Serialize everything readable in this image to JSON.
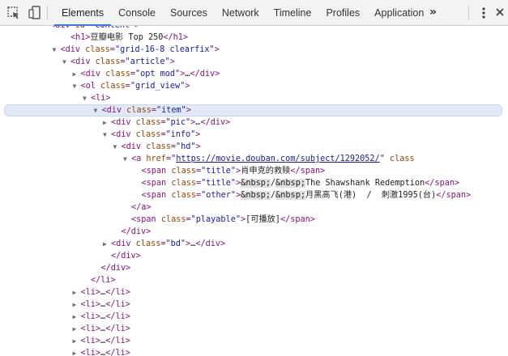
{
  "toolbar": {
    "tabs": [
      {
        "label": "Elements",
        "active": true
      },
      {
        "label": "Console",
        "active": false
      },
      {
        "label": "Sources",
        "active": false
      },
      {
        "label": "Network",
        "active": false
      },
      {
        "label": "Timeline",
        "active": false
      },
      {
        "label": "Profiles",
        "active": false
      },
      {
        "label": "Application",
        "active": false
      }
    ],
    "more_label": "»",
    "icons": [
      "inspect-element-icon",
      "device-toolbar-icon",
      "kebab-menu-icon",
      "close-icon"
    ],
    "active_color": "#3879d9"
  },
  "tree": {
    "lines": [
      {
        "indent": 4,
        "toggle": "",
        "segs": [
          [
            "tag",
            "<div "
          ],
          [
            "an",
            "id"
          ],
          [
            "tag",
            "="
          ],
          [
            "av",
            "\"content\""
          ],
          [
            "tag",
            ">"
          ]
        ]
      },
      {
        "indent": 6,
        "toggle": "",
        "segs": [
          [
            "tag",
            "<h1>"
          ],
          [
            "txt",
            "豆瓣电影 Top 250"
          ],
          [
            "tag",
            "</h1>"
          ]
        ]
      },
      {
        "indent": 5,
        "toggle": "open",
        "segs": [
          [
            "tag",
            "<div "
          ],
          [
            "an",
            "class"
          ],
          [
            "tag",
            "="
          ],
          [
            "av",
            "\"grid-16-8 clearfix\""
          ],
          [
            "tag",
            ">"
          ]
        ]
      },
      {
        "indent": 6,
        "toggle": "open",
        "segs": [
          [
            "tag",
            "<div "
          ],
          [
            "an",
            "class"
          ],
          [
            "tag",
            "="
          ],
          [
            "av",
            "\"article\""
          ],
          [
            "tag",
            ">"
          ]
        ]
      },
      {
        "indent": 7,
        "toggle": "closed",
        "segs": [
          [
            "tag",
            "<div "
          ],
          [
            "an",
            "class"
          ],
          [
            "tag",
            "="
          ],
          [
            "av",
            "\"opt mod\""
          ],
          [
            "tag",
            ">"
          ],
          [
            "ell",
            "…"
          ],
          [
            "tag",
            "</div>"
          ]
        ]
      },
      {
        "indent": 7,
        "toggle": "open",
        "segs": [
          [
            "tag",
            "<ol "
          ],
          [
            "an",
            "class"
          ],
          [
            "tag",
            "="
          ],
          [
            "av",
            "\"grid_view\""
          ],
          [
            "tag",
            ">"
          ]
        ]
      },
      {
        "indent": 8,
        "toggle": "open",
        "segs": [
          [
            "tag",
            "<li>"
          ]
        ]
      },
      {
        "indent": 9,
        "toggle": "open",
        "selected": true,
        "segs": [
          [
            "tag",
            "<div "
          ],
          [
            "an",
            "class"
          ],
          [
            "tag",
            "="
          ],
          [
            "av",
            "\"item\""
          ],
          [
            "tag",
            ">"
          ]
        ]
      },
      {
        "indent": 10,
        "toggle": "closed",
        "segs": [
          [
            "tag",
            "<div "
          ],
          [
            "an",
            "class"
          ],
          [
            "tag",
            "="
          ],
          [
            "av",
            "\"pic\""
          ],
          [
            "tag",
            ">"
          ],
          [
            "ell",
            "…"
          ],
          [
            "tag",
            "</div>"
          ]
        ]
      },
      {
        "indent": 10,
        "toggle": "open",
        "segs": [
          [
            "tag",
            "<div "
          ],
          [
            "an",
            "class"
          ],
          [
            "tag",
            "="
          ],
          [
            "av",
            "\"info\""
          ],
          [
            "tag",
            ">"
          ]
        ]
      },
      {
        "indent": 11,
        "toggle": "open",
        "segs": [
          [
            "tag",
            "<div "
          ],
          [
            "an",
            "class"
          ],
          [
            "tag",
            "="
          ],
          [
            "av",
            "\"hd\""
          ],
          [
            "tag",
            ">"
          ]
        ]
      },
      {
        "indent": 12,
        "toggle": "open",
        "segs": [
          [
            "tag",
            "<a "
          ],
          [
            "an",
            "href"
          ],
          [
            "tag",
            "="
          ],
          [
            "av",
            "\""
          ],
          [
            "link",
            "https://movie.douban.com/subject/1292052/"
          ],
          [
            "av",
            "\""
          ],
          [
            "tag",
            " "
          ],
          [
            "an",
            "class"
          ]
        ]
      },
      {
        "indent": 13,
        "toggle": "",
        "segs": [
          [
            "tag",
            "<span "
          ],
          [
            "an",
            "class"
          ],
          [
            "tag",
            "="
          ],
          [
            "av",
            "\"title\""
          ],
          [
            "tag",
            ">"
          ],
          [
            "txt",
            "肖申克的救赎"
          ],
          [
            "tag",
            "</span>"
          ]
        ]
      },
      {
        "indent": 13,
        "toggle": "",
        "segs": [
          [
            "tag",
            "<span "
          ],
          [
            "an",
            "class"
          ],
          [
            "tag",
            "="
          ],
          [
            "av",
            "\"title\""
          ],
          [
            "tag",
            ">"
          ],
          [
            "ent",
            "&nbsp;"
          ],
          [
            "txt",
            "/"
          ],
          [
            "ent",
            "&nbsp;"
          ],
          [
            "txt",
            "The Shawshank Redemption"
          ],
          [
            "tag",
            "</span>"
          ]
        ]
      },
      {
        "indent": 13,
        "toggle": "",
        "segs": [
          [
            "tag",
            "<span "
          ],
          [
            "an",
            "class"
          ],
          [
            "tag",
            "="
          ],
          [
            "av",
            "\"other\""
          ],
          [
            "tag",
            ">"
          ],
          [
            "ent",
            "&nbsp;"
          ],
          [
            "txt",
            "/"
          ],
          [
            "ent",
            "&nbsp;"
          ],
          [
            "txt",
            "月黑高飞(港)  /  刺激1995(台)"
          ],
          [
            "tag",
            "</span>"
          ]
        ]
      },
      {
        "indent": 12,
        "toggle": "",
        "segs": [
          [
            "tag",
            "</a>"
          ]
        ]
      },
      {
        "indent": 12,
        "toggle": "",
        "segs": [
          [
            "tag",
            "<span "
          ],
          [
            "an",
            "class"
          ],
          [
            "tag",
            "="
          ],
          [
            "av",
            "\"playable\""
          ],
          [
            "tag",
            ">"
          ],
          [
            "txt",
            "[可播放]"
          ],
          [
            "tag",
            "</span>"
          ]
        ]
      },
      {
        "indent": 11,
        "toggle": "",
        "segs": [
          [
            "tag",
            "</div>"
          ]
        ]
      },
      {
        "indent": 10,
        "toggle": "closed",
        "segs": [
          [
            "tag",
            "<div "
          ],
          [
            "an",
            "class"
          ],
          [
            "tag",
            "="
          ],
          [
            "av",
            "\"bd\""
          ],
          [
            "tag",
            ">"
          ],
          [
            "ell",
            "…"
          ],
          [
            "tag",
            "</div>"
          ]
        ]
      },
      {
        "indent": 10,
        "toggle": "",
        "segs": [
          [
            "tag",
            "</div>"
          ]
        ]
      },
      {
        "indent": 9,
        "toggle": "",
        "segs": [
          [
            "tag",
            "</div>"
          ]
        ]
      },
      {
        "indent": 8,
        "toggle": "",
        "segs": [
          [
            "tag",
            "</li>"
          ]
        ]
      },
      {
        "indent": 7,
        "toggle": "closed",
        "segs": [
          [
            "tag",
            "<li>"
          ],
          [
            "ell",
            "…"
          ],
          [
            "tag",
            "</li>"
          ]
        ]
      },
      {
        "indent": 7,
        "toggle": "closed",
        "segs": [
          [
            "tag",
            "<li>"
          ],
          [
            "ell",
            "…"
          ],
          [
            "tag",
            "</li>"
          ]
        ]
      },
      {
        "indent": 7,
        "toggle": "closed",
        "segs": [
          [
            "tag",
            "<li>"
          ],
          [
            "ell",
            "…"
          ],
          [
            "tag",
            "</li>"
          ]
        ]
      },
      {
        "indent": 7,
        "toggle": "closed",
        "segs": [
          [
            "tag",
            "<li>"
          ],
          [
            "ell",
            "…"
          ],
          [
            "tag",
            "</li>"
          ]
        ]
      },
      {
        "indent": 7,
        "toggle": "closed",
        "segs": [
          [
            "tag",
            "<li>"
          ],
          [
            "ell",
            "…"
          ],
          [
            "tag",
            "</li>"
          ]
        ]
      },
      {
        "indent": 7,
        "toggle": "closed",
        "segs": [
          [
            "tag",
            "<li>"
          ],
          [
            "ell",
            "…"
          ],
          [
            "tag",
            "</li>"
          ]
        ]
      }
    ]
  }
}
